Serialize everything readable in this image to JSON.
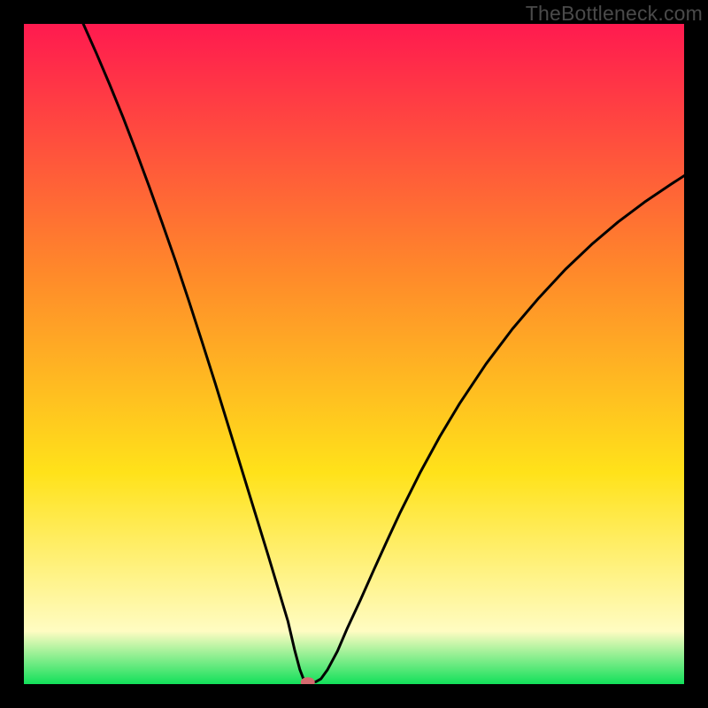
{
  "watermark": "TheBottleneck.com",
  "colors": {
    "grad_top": "#ff1a4f",
    "grad_mid1": "#ff8a2a",
    "grad_mid2": "#ffe21a",
    "grad_low": "#fffcc2",
    "grad_bottom": "#12e05a",
    "line": "#000000",
    "marker": "#d66a6f",
    "frame": "#000000"
  },
  "chart_data": {
    "type": "line",
    "title": "",
    "xlabel": "",
    "ylabel": "",
    "xlim": [
      0,
      100
    ],
    "ylim": [
      0,
      100
    ],
    "x": [
      9,
      11,
      13,
      15,
      17,
      19,
      21,
      23,
      25,
      27,
      29,
      31,
      33,
      35,
      37,
      38.5,
      40,
      41,
      41.8,
      42.3,
      42.7,
      43,
      43.5,
      44.2,
      45,
      46,
      47.5,
      49,
      51,
      53,
      55,
      57,
      60,
      63,
      66,
      70,
      74,
      78,
      82,
      86,
      90,
      94,
      98,
      100
    ],
    "values": [
      100,
      95.5,
      90.8,
      85.9,
      80.7,
      75.3,
      69.7,
      64,
      58,
      51.8,
      45.5,
      39,
      32.5,
      26,
      19.5,
      14.5,
      9.5,
      5.2,
      2.2,
      0.9,
      0.4,
      0.3,
      0.3,
      0.35,
      0.8,
      2.2,
      5.0,
      8.5,
      12.8,
      17.3,
      21.7,
      26.0,
      32.0,
      37.5,
      42.5,
      48.5,
      53.8,
      58.5,
      62.8,
      66.6,
      70.0,
      73.0,
      75.7,
      77.0
    ],
    "marker": {
      "x": 43,
      "y": 0.3
    },
    "annotations": []
  }
}
